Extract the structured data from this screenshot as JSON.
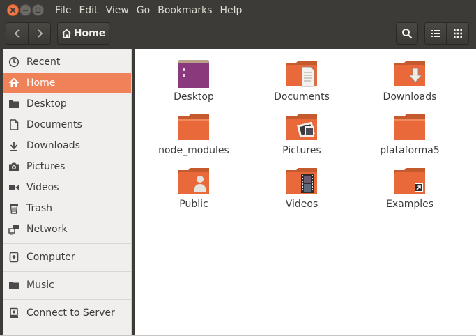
{
  "menubar": {
    "items": [
      "File",
      "Edit",
      "View",
      "Go",
      "Bookmarks",
      "Help"
    ]
  },
  "toolbar": {
    "breadcrumb_label": "Home"
  },
  "sidebar": {
    "items": [
      {
        "label": "Recent",
        "icon": "clock-icon"
      },
      {
        "label": "Home",
        "icon": "home-icon",
        "active": true
      },
      {
        "label": "Desktop",
        "icon": "folder-icon"
      },
      {
        "label": "Documents",
        "icon": "document-icon"
      },
      {
        "label": "Downloads",
        "icon": "download-icon"
      },
      {
        "label": "Pictures",
        "icon": "camera-icon"
      },
      {
        "label": "Videos",
        "icon": "video-icon"
      },
      {
        "label": "Trash",
        "icon": "trash-icon"
      },
      {
        "label": "Network",
        "icon": "network-icon"
      },
      {
        "label": "Computer",
        "icon": "drive-icon"
      },
      {
        "label": "Music",
        "icon": "folder-icon"
      },
      {
        "label": "Connect to Server",
        "icon": "server-icon"
      }
    ]
  },
  "files": [
    {
      "name": "Desktop",
      "icon": "desktop-folder-icon"
    },
    {
      "name": "Documents",
      "icon": "documents-folder-icon"
    },
    {
      "name": "Downloads",
      "icon": "downloads-folder-icon"
    },
    {
      "name": "node_modules",
      "icon": "folder-icon"
    },
    {
      "name": "Pictures",
      "icon": "pictures-folder-icon"
    },
    {
      "name": "plataforma5",
      "icon": "folder-icon"
    },
    {
      "name": "Public",
      "icon": "public-folder-icon"
    },
    {
      "name": "Videos",
      "icon": "videos-folder-icon"
    },
    {
      "name": "Examples",
      "icon": "examples-folder-icon"
    }
  ],
  "colors": {
    "accent": "#f0825a",
    "folder": "#e9693a",
    "titlebar": "#3c3b37"
  }
}
